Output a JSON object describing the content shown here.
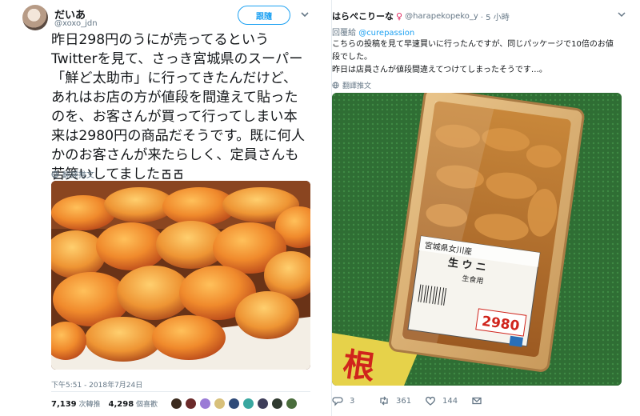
{
  "left_tweet": {
    "name": "だいあ",
    "handle": "@xoxo_jdn",
    "follow_label": "跟隨",
    "text_lines": [
      "昨日298円のうにが売ってるという",
      "Twitterを見て、さっき宮城県のスーパー",
      "「鮮ど太助市」に行ってきたんだけど、",
      "あれはお店の方が値段を間違えて貼った",
      "のを、お客さんが買って行ってしまい本",
      "来は2980円の商品だそうです。既に何人",
      "かのお客さんが来たらしく、定員さんも",
      "苦笑いしてました"
    ],
    "translate_label": "翻譯推文",
    "timestamp": "下午5:51 - 2018年7月24日",
    "retweets_count": "7,139",
    "retweets_label": "次轉推",
    "likes_count": "4,298",
    "likes_label": "個喜歡",
    "liker_colors": [
      "#3b2b1e",
      "#6b2a2a",
      "#9a7bd6",
      "#d8c07a",
      "#2e4a78",
      "#39a7a0",
      "#3e3e5a",
      "#2f3a2f",
      "#4a6d3c"
    ]
  },
  "right_tweet": {
    "name": "はらぺこりーな",
    "gender_icon": "♀",
    "handle": "@harapekopeko_y",
    "time": "· 5 小時",
    "reply_prefix": "回覆給",
    "reply_mention": "@curepassion",
    "text_lines": [
      "こちらの投稿を見て早速買いに行ったんですが、同じパッケージで10倍のお値",
      "段でした。",
      "昨日は店員さんが値段間違えてつけてしまったそうです…。"
    ],
    "translate_label": "翻譯推文",
    "photo_label": {
      "origin": "宮城県女川産",
      "product": "生 ウ ニ",
      "use": "生食用",
      "price": "2980",
      "sign": "根"
    },
    "reply_count": "3",
    "retweet_count": "361",
    "like_count": "144"
  },
  "colors": {
    "link": "#1da1f2",
    "secondary": "#657786",
    "uni_orange": "#e8782a",
    "price_red": "#d0241c"
  }
}
